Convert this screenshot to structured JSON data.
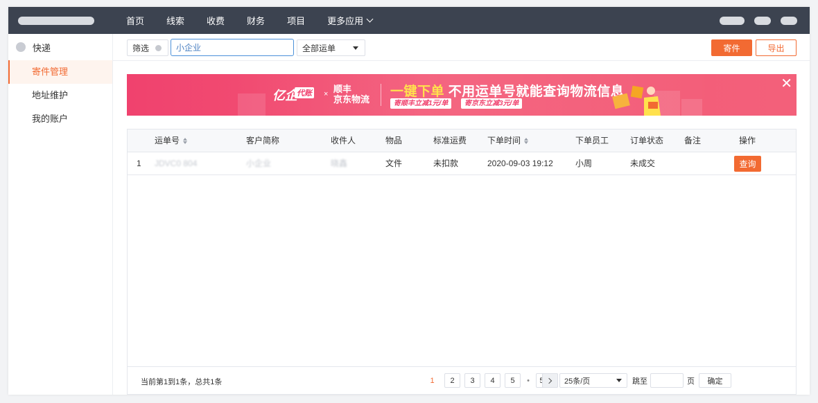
{
  "topnav": {
    "items": [
      {
        "label": "首页"
      },
      {
        "label": "线索"
      },
      {
        "label": "收费"
      },
      {
        "label": "财务"
      },
      {
        "label": "项目"
      },
      {
        "label": "更多应用"
      }
    ]
  },
  "sidebar": {
    "header": "快递",
    "items": [
      {
        "label": "寄件管理",
        "active": true
      },
      {
        "label": "地址维护",
        "active": false
      },
      {
        "label": "我的账户",
        "active": false
      }
    ]
  },
  "toolbar": {
    "filter_label": "筛选",
    "search_value": "小企业",
    "select_value": "全部运单",
    "send_label": "寄件",
    "export_label": "导出"
  },
  "banner": {
    "brand": "亿企",
    "brand_tag": "代账",
    "times": "×",
    "partner_line1": "顺丰",
    "partner_line2": "京东物流",
    "headline_hl": "一键下单",
    "headline_rest": "不用运单号就能查询物流信息",
    "tag1": "寄顺丰立减1元/单",
    "tag2": "寄京东立减3元/单",
    "close_glyph": "✕"
  },
  "table": {
    "columns": [
      "运单号",
      "客户简称",
      "收件人",
      "物品",
      "标准运费",
      "下单时间",
      "下单员工",
      "订单状态",
      "备注",
      "操作"
    ],
    "rows": [
      {
        "index": "1",
        "waybill": "JDVC0 804",
        "customer": "小企业",
        "recipient": "晓鑫",
        "item": "文件",
        "fee": "未扣款",
        "time": "2020-09-03 19:12",
        "staff": "小周",
        "status": "未成交",
        "note": "",
        "action": "查询"
      }
    ]
  },
  "footer": {
    "info": "当前第1到1条，总共1条",
    "pages": [
      "1",
      "2",
      "3",
      "4",
      "5"
    ],
    "ellipsis": "•",
    "last_page": "58",
    "current_page": "1",
    "page_size": "25条/页",
    "jump_label": "跳至",
    "page_unit": "页",
    "confirm_label": "确定"
  },
  "colors": {
    "accent": "#f26a32",
    "topbar": "#3c4350",
    "banner": "#f0426e",
    "focus": "#4a90d9"
  }
}
